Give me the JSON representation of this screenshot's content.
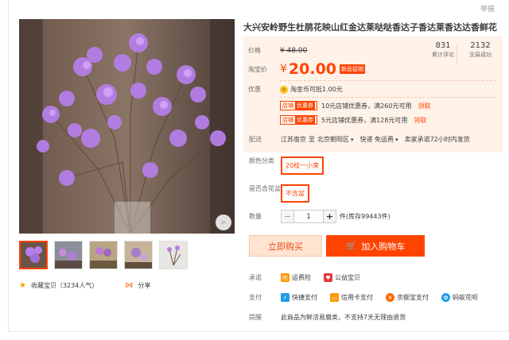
{
  "report": "举报",
  "title": "大兴安岭野生杜鹃花映山红金达莱哒哒香达子香达莱香达达香鲜花",
  "price": {
    "label": "价格",
    "original": "¥ 48.00",
    "taobao_label": "淘宝价",
    "currency": "¥",
    "current": "20.00",
    "promo_tag": "新品促销",
    "reviews_count": "831",
    "reviews_label": "累计评论",
    "sales_count": "2132",
    "sales_label": "交易成功"
  },
  "offers": {
    "label": "优惠",
    "coin_text": "淘金币可抵1.00元",
    "coupons": [
      {
        "tag1": "店铺",
        "tag2": "优惠券",
        "text": "10元店铺优惠券，满260元可用",
        "action": "领取"
      },
      {
        "tag1": "店铺",
        "tag2": "优惠券",
        "text": "5元店铺优惠券，满128元可用",
        "action": "领取"
      }
    ]
  },
  "delivery": {
    "label": "配送",
    "from": "江苏南京",
    "to_word": "至",
    "to": "北京朝阳区",
    "method": "快递 免运费",
    "promise": "卖家承诺72小时内发货"
  },
  "color": {
    "label": "颜色分类",
    "value": "20枝一小束"
  },
  "vase": {
    "label": "是否含花盆",
    "value": "不含盆"
  },
  "quantity": {
    "label": "数量",
    "value": "1",
    "minus": "−",
    "plus": "+",
    "stock": "件(库存99443件)"
  },
  "buttons": {
    "buy": "立即购买",
    "cart": "加入购物车"
  },
  "promise": {
    "label": "承诺",
    "items": [
      "运费险",
      "公益宝贝"
    ]
  },
  "payment": {
    "label": "支付",
    "items": [
      "快捷支付",
      "信用卡支付",
      "余额宝支付",
      "蚂蚁花呗"
    ]
  },
  "reminder": {
    "label": "提醒",
    "text": "此商品为鲜活易腐类，不支持7天无理由退货"
  },
  "social": {
    "favorite": "收藏宝贝（3234人气）",
    "share": "分享"
  },
  "colors": {
    "accent": "#ff4400",
    "price_bg": "#fff2e8"
  }
}
